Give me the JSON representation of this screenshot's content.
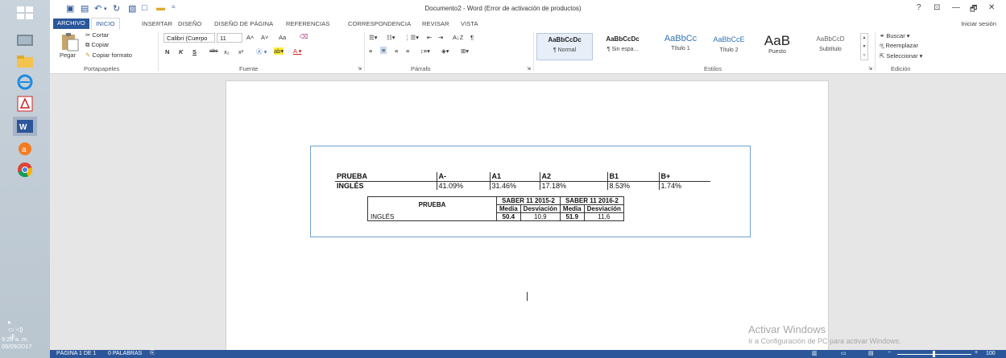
{
  "window": {
    "title": "Documento2 - Word (Error de activación de productos)",
    "controls": [
      "?",
      "⊡",
      "—",
      "🗗",
      "✕"
    ]
  },
  "tabs": [
    "ARCHIVO",
    "INICIO",
    "INSERTAR",
    "DISEÑO",
    "DISEÑO DE PÁGINA",
    "REFERENCIAS",
    "CORRESPONDENCIA",
    "REVISAR",
    "VISTA"
  ],
  "active_tab": "INICIO",
  "signin": "Iniciar sesión",
  "ribbon": {
    "clipboard": {
      "paste": "Pegar",
      "cut": "Cortar",
      "copy": "Copiar",
      "format_painter": "Copiar formato",
      "label": "Portapapeles"
    },
    "font": {
      "name": "Calibri (Cuerpo",
      "size": "11",
      "bold": "N",
      "italic": "K",
      "underline": "S",
      "strike": "abc",
      "sub": "x₂",
      "sup": "x²",
      "grow": "A˄",
      "shrink": "A˅",
      "case": "Aa",
      "label": "Fuente"
    },
    "paragraph": {
      "label": "Párrafo",
      "sort": "A↓Z",
      "marks": "¶"
    },
    "styles": {
      "label": "Estilos",
      "items": [
        {
          "sample": "AaBbCcDc",
          "name": "¶ Normal"
        },
        {
          "sample": "AaBbCcDc",
          "name": "¶ Sin espa..."
        },
        {
          "sample": "AaBbCc",
          "name": "Título 1"
        },
        {
          "sample": "AaBbCcE",
          "name": "Título 2"
        },
        {
          "sample": "AaB",
          "name": "Puesto"
        },
        {
          "sample": "AaBbCcD",
          "name": "Subtítulo"
        }
      ]
    },
    "editing": {
      "find": "Buscar",
      "replace": "Reemplazar",
      "select": "Seleccionar",
      "label": "Edición"
    }
  },
  "document": {
    "table1": {
      "headers": [
        "PRUEBA",
        "A-",
        "A1",
        "A2",
        "B1",
        "B+"
      ],
      "row": [
        "INGLÉS",
        "41.09%",
        "31.46%",
        "17.18%",
        "8.53%",
        "1.74%"
      ]
    },
    "table2": {
      "prueba": "PRUEBA",
      "ingles": "INGLÉS",
      "group1": "SABER 11 2015-2",
      "group2": "SABER 11 2016-2",
      "media": "Media",
      "desviacion": "Desviación",
      "values": [
        "50.4",
        "10,9",
        "51.9",
        "11,6"
      ]
    }
  },
  "watermark": {
    "line1": "Activar Windows",
    "line2": "Ir a Configuración de PC para activar Windows."
  },
  "status": {
    "page": "PÁGINA 1 DE 1",
    "words": "0 PALABRAS",
    "zoom": "100"
  },
  "tray": {
    "time": "9:28 a. m.",
    "date": "05/09/2017"
  },
  "colors": {
    "word_blue": "#2b579a",
    "textbox_border": "#6ea2cf"
  }
}
